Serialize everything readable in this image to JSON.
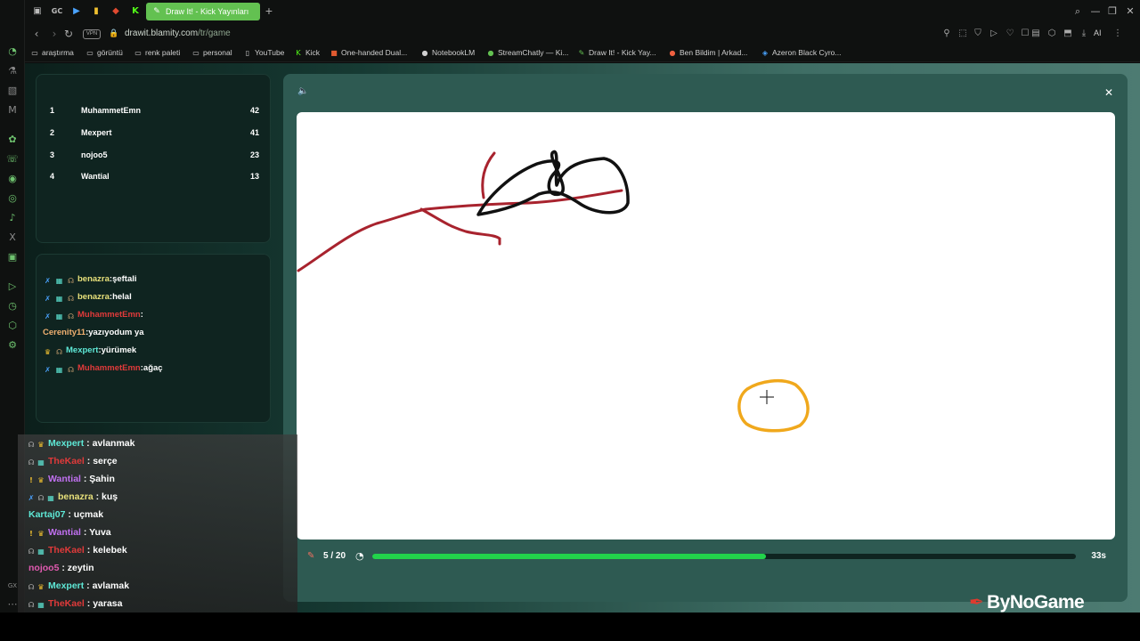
{
  "tabs": {
    "pinned": [
      {
        "icon": "opera-icon",
        "glyph": "O"
      },
      {
        "icon": "game-icon",
        "glyph": "▣"
      },
      {
        "icon": "gc-icon",
        "glyph": "GC"
      },
      {
        "icon": "play-icon",
        "glyph": "▶"
      },
      {
        "icon": "bars-icon",
        "glyph": "▮"
      },
      {
        "icon": "diamond-icon",
        "glyph": "◆"
      },
      {
        "icon": "kick-icon",
        "glyph": "K"
      }
    ],
    "active_title": "Draw It! - Kick Yayınları"
  },
  "address": {
    "vpn_label": "VPN",
    "url_host": "drawit.blamity.com",
    "url_path": "/tr/game",
    "ai_label": "AI"
  },
  "bookmarks": [
    {
      "label": "araştırma",
      "icon": "folder-icon"
    },
    {
      "label": "görüntü",
      "icon": "folder-icon"
    },
    {
      "label": "renk paleti",
      "icon": "folder-icon"
    },
    {
      "label": "personal",
      "icon": "folder-icon"
    },
    {
      "label": "YouTube",
      "icon": "page-icon"
    },
    {
      "label": "Kick",
      "icon": "kick-icon"
    },
    {
      "label": "One-handed Dual...",
      "icon": "page-icon"
    },
    {
      "label": "NotebookLM",
      "icon": "notebook-icon"
    },
    {
      "label": "StreamChatly — Ki...",
      "icon": "chat-icon"
    },
    {
      "label": "Draw It! - Kick Yay...",
      "icon": "brush-icon"
    },
    {
      "label": "Ben Bildim | Arkad...",
      "icon": "bulb-icon"
    },
    {
      "label": "Azeron Black Cyro...",
      "icon": "gamepad-icon"
    }
  ],
  "leaderboard": [
    {
      "rank": "1",
      "name": "MuhammetEmn",
      "score": "42"
    },
    {
      "rank": "2",
      "name": "Mexpert",
      "score": "41"
    },
    {
      "rank": "3",
      "name": "nojoo5",
      "score": "23"
    },
    {
      "rank": "4",
      "name": "Wantial",
      "score": "13"
    }
  ],
  "game_chat": [
    {
      "user": "benazra",
      "msg": "şeftali",
      "color": "#e7e07a",
      "badges": [
        "✗",
        "▦",
        "☊"
      ]
    },
    {
      "user": "benazra",
      "msg": "helal",
      "color": "#e7e07a",
      "badges": [
        "✗",
        "▦",
        "☊"
      ]
    },
    {
      "user": "MuhammetEmn",
      "msg": "",
      "color": "#e03a3a",
      "badges": [
        "✗",
        "▦",
        "☊"
      ]
    },
    {
      "user": "Cerenity11",
      "msg": "yazıyodum ya",
      "color": "#f0b070",
      "badges": []
    },
    {
      "user": "Mexpert",
      "msg": "yürümek",
      "color": "#5ee8d6",
      "badges": [
        "♛",
        "☊"
      ]
    },
    {
      "user": "MuhammetEmn",
      "msg": "ağaç",
      "color": "#e03a3a",
      "badges": [
        "✗",
        "▦",
        "☊"
      ]
    }
  ],
  "game": {
    "round": "5 / 20",
    "time": "33s",
    "progress": 0.56
  },
  "stream_chat": [
    {
      "user": "Mexpert",
      "msg": "avlanmak",
      "color": "#5ee8d6",
      "badges": [
        "☊",
        "♛"
      ]
    },
    {
      "user": "TheKael",
      "msg": "serçe",
      "color": "#e03a3a",
      "badges": [
        "☊",
        "▦"
      ]
    },
    {
      "user": "Wantial",
      "msg": "Şahin",
      "color": "#c070f0",
      "badges": [
        "!",
        "♛"
      ]
    },
    {
      "user": "benazra",
      "msg": "kuş",
      "color": "#e7e07a",
      "badges": [
        "✗",
        "☊",
        "▦"
      ]
    },
    {
      "user": "Kartaj07",
      "msg": "uçmak",
      "color": "#5ee8d6",
      "badges": []
    },
    {
      "user": "Wantial",
      "msg": "Yuva",
      "color": "#c070f0",
      "badges": [
        "!",
        "♛"
      ]
    },
    {
      "user": "TheKael",
      "msg": "kelebek",
      "color": "#e03a3a",
      "badges": [
        "☊",
        "▦"
      ]
    },
    {
      "user": "nojoo5",
      "msg": "zeytin",
      "color": "#e05ab0",
      "badges": []
    },
    {
      "user": "Mexpert",
      "msg": "avlamak",
      "color": "#5ee8d6",
      "badges": [
        "☊",
        "♛"
      ]
    },
    {
      "user": "TheKael",
      "msg": "yarasa",
      "color": "#e03a3a",
      "badges": [
        "☊",
        "▦"
      ]
    }
  ],
  "branding": {
    "name": "ByNoGame"
  },
  "colors": {
    "accent": "#63c151",
    "progress": "#22d34b",
    "panel": "#0f2420"
  }
}
